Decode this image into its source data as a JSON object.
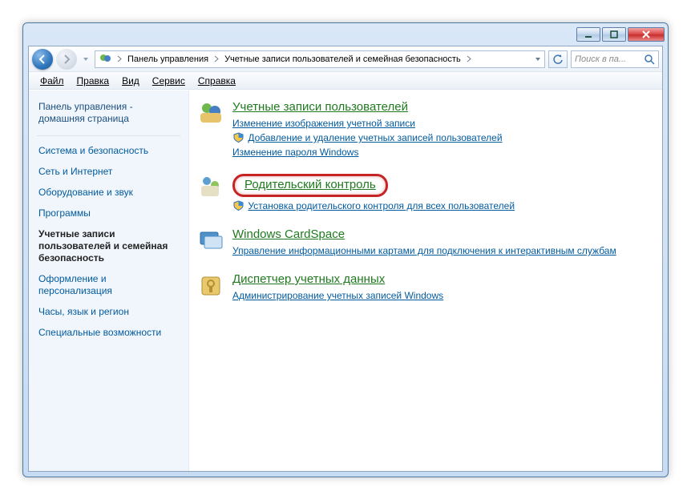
{
  "breadcrumb": {
    "items": [
      "Панель управления",
      "Учетные записи пользователей и семейная безопасность"
    ]
  },
  "search": {
    "placeholder": "Поиск в па..."
  },
  "menu": {
    "file": "Файл",
    "edit": "Правка",
    "view": "Вид",
    "tools": "Сервис",
    "help": "Справка"
  },
  "sidebar": {
    "home": "Панель управления - домашняя страница",
    "items": [
      "Система и безопасность",
      "Сеть и Интернет",
      "Оборудование и звук",
      "Программы",
      "Учетные записи пользователей и семейная безопасность",
      "Оформление и персонализация",
      "Часы, язык и регион",
      "Специальные возможности"
    ]
  },
  "categories": [
    {
      "title": "Учетные записи пользователей",
      "links": [
        {
          "text": "Изменение изображения учетной записи",
          "shield": false
        },
        {
          "text": "Добавление и удаление учетных записей пользователей",
          "shield": true
        },
        {
          "text": "Изменение пароля Windows",
          "shield": false
        }
      ]
    },
    {
      "title": "Родительский контроль",
      "links": [
        {
          "text": "Установка родительского контроля для всех пользователей",
          "shield": true
        }
      ]
    },
    {
      "title": "Windows CardSpace",
      "links": [
        {
          "text": "Управление информационными картами для подключения к интерактивным службам",
          "shield": false
        }
      ]
    },
    {
      "title": "Диспетчер учетных данных",
      "links": [
        {
          "text": "Администрирование учетных записей Windows",
          "shield": false
        }
      ]
    }
  ]
}
